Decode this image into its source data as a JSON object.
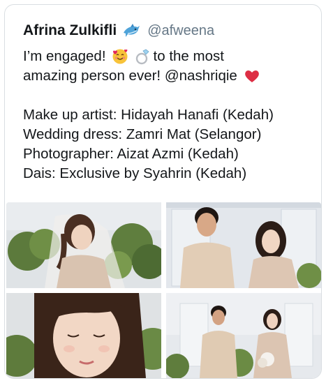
{
  "author": {
    "display_name": "Afrina Zulkifli",
    "name_emoji": "dolphin-icon",
    "handle": "@afweena"
  },
  "tweet": {
    "line1_before": "I’m engaged!",
    "line1_after": "to the most",
    "line2_text": "amazing person ever! @nashriqie",
    "line1_emojis": [
      "smiling-face-with-hearts-icon",
      "ring-icon"
    ],
    "line2_emoji": "red-heart-icon",
    "credits": [
      "Make up artist: Hidayah Hanafi (Kedah)",
      "Wedding dress: Zamri Mat (Selangor)",
      "Photographer: Aizat Azmi (Kedah)",
      "Dais: Exclusive by Syahrin (Kedah)"
    ]
  },
  "media": {
    "photos": [
      {
        "subject": "bride-portrait-with-veil"
      },
      {
        "subject": "couple-standing-portrait"
      },
      {
        "subject": "bride-closeup-eyes-closed"
      },
      {
        "subject": "couple-on-dais"
      }
    ]
  },
  "colors": {
    "text": "#14171a",
    "secondary": "#657786",
    "border": "#d9dee2"
  }
}
